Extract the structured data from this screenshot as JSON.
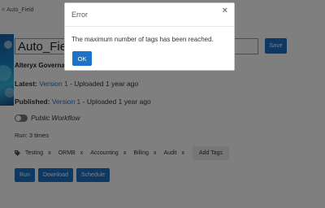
{
  "breadcrumb": {
    "back_label": "Auto_Field"
  },
  "workflow": {
    "title_value": "Auto_Field",
    "save_label": "Save",
    "owner": "Alteryx Governa",
    "latest_label": "Latest:",
    "latest_version": "Version 1",
    "latest_suffix": "- Uploaded 1 year ago",
    "published_label": "Published:",
    "published_version": "Version 1",
    "published_suffix": "- Uploaded 1 year ago",
    "public_label": "Public Workflow",
    "runs_text": "Run: 3 times"
  },
  "tags": {
    "items": [
      "Testing",
      "ORMB",
      "Accounting",
      "Billing",
      "Audit"
    ],
    "remove_glyph": "x",
    "add_label": "Add Tags"
  },
  "actions": {
    "run_label": "Run",
    "download_label": "Download",
    "schedule_label": "Schedule"
  },
  "modal": {
    "title": "Error",
    "close_glyph": "×",
    "message": "The maximum number of tags has been reached.",
    "ok_label": "OK"
  },
  "colors": {
    "accent": "#1a73c7",
    "overlay": "rgba(0,0,0,0.5)"
  },
  "icons": {
    "breadcrumb": "chevron-left-icon",
    "tag": "tag-icon",
    "close": "close-icon"
  }
}
